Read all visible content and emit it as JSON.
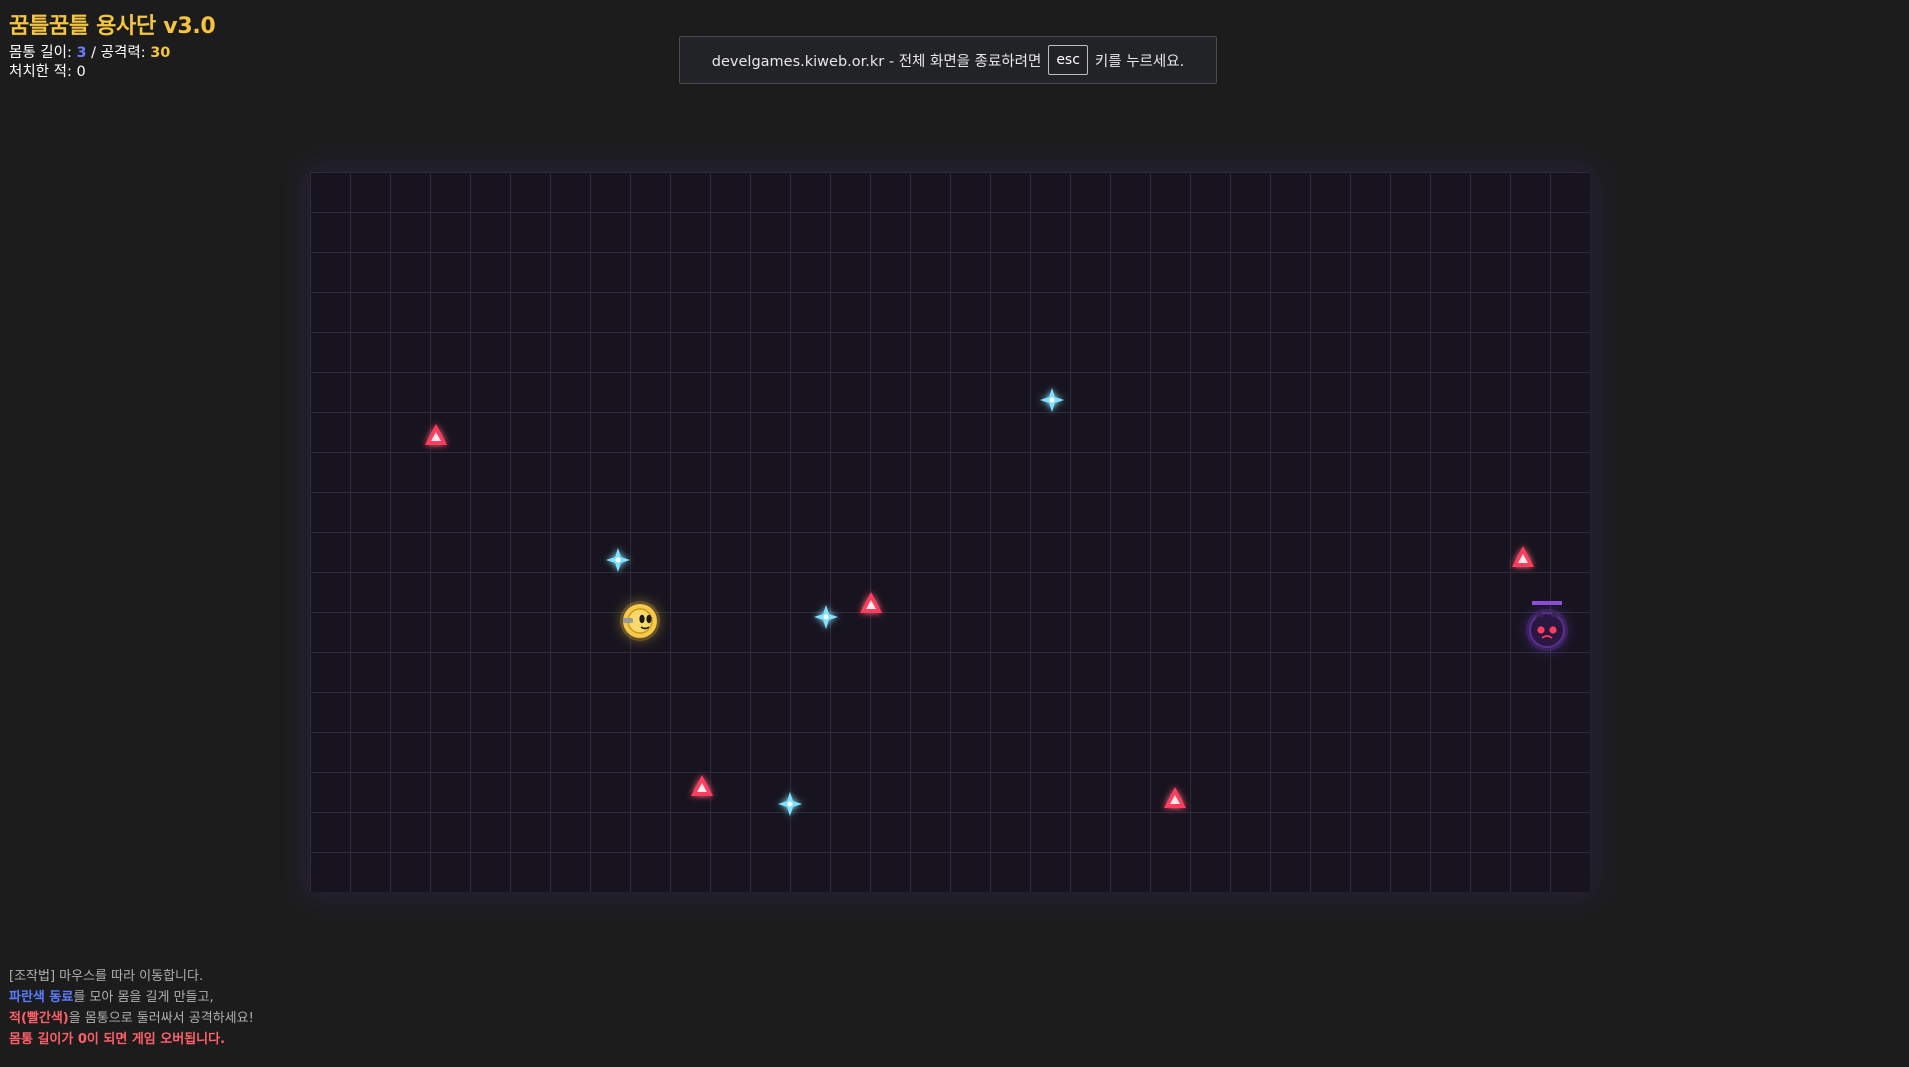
{
  "hud": {
    "title": "꿈틀꿈틀 용사단 v3.0",
    "length_label": "몸통 길이: ",
    "length_value": "3",
    "separator": " / ",
    "attack_label": "공격력: ",
    "attack_value": "30",
    "kills_label": "처치한 적: ",
    "kills_value": "0"
  },
  "fullscreen_banner": {
    "text_before": "develgames.kiweb.or.kr - 전체 화면을 종료하려면",
    "key": "esc",
    "text_after": "키를 누르세요."
  },
  "help": {
    "line1": "[조작법] 마우스를 따라 이동합니다.",
    "line2_highlight": "파란색 동료",
    "line2_rest": "를 모아 몸을 길게 만들고,",
    "line3_highlight": "적(빨간색)",
    "line3_rest": "을 몸통으로 둘러싸서 공격하세요!",
    "line4": "몸통 길이가 0이 되면 게임 오버됩니다."
  },
  "colors": {
    "accent_yellow": "#f5c542",
    "ally_blue": "#6ad8ff",
    "enemy_red": "#ff3d5f",
    "boss_purple": "#8a4fd8",
    "board_bg": "#17141f",
    "grid_line": "#2f2b3d"
  },
  "icons": {
    "player": "player-hero-icon",
    "ally": "blue-sparkle-ally-icon",
    "enemy": "red-triangle-enemy-icon",
    "boss": "purple-boss-enemy-icon"
  }
}
